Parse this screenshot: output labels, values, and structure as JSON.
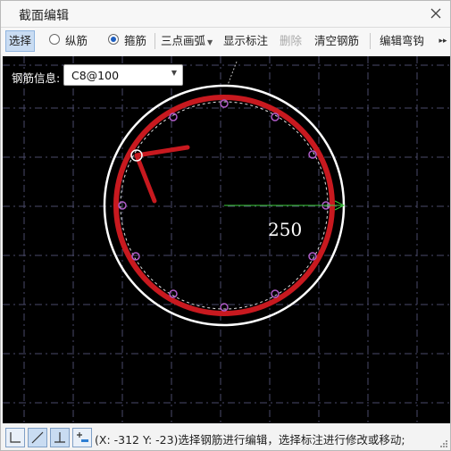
{
  "window": {
    "title": "截面编辑"
  },
  "toolbar": {
    "select": "选择",
    "longitudinal": "纵筋",
    "stirrup": "箍筋",
    "arc_mode": "三点画弧",
    "show_dimension": "显示标注",
    "delete": "删除",
    "clear_rebar": "清空钢筋",
    "edit_hook": "编辑弯钩",
    "selected_type": "stirrup"
  },
  "rebar_info": {
    "label": "钢筋信息:",
    "value": "C8@100"
  },
  "drawing": {
    "dimension_text": "250",
    "colors": {
      "background": "#000000",
      "grid": "#4a4a6a",
      "concrete_outline": "#ffffff",
      "stirrup": "#c8191f",
      "rebar_points": "#b05cc8",
      "dimension_line": "#3bd13b"
    }
  },
  "statusbar": {
    "text": "(X: -312 Y: -23)选择钢筋进行编辑，选择标注进行修改或移动;"
  }
}
